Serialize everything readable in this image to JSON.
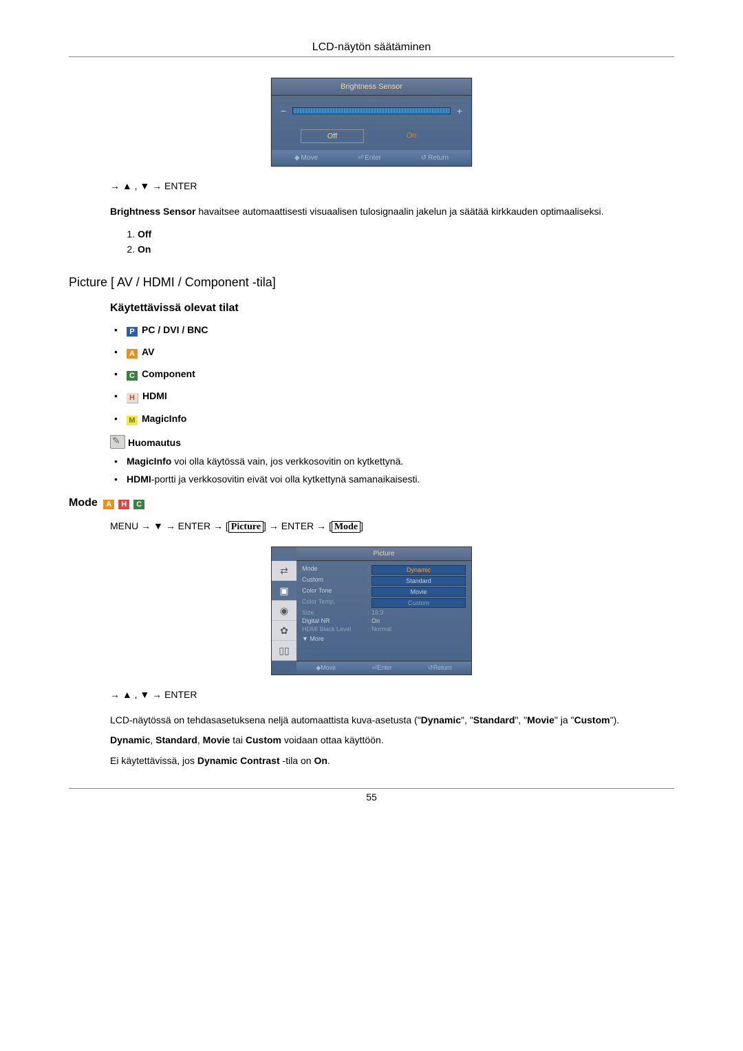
{
  "header": {
    "title": "LCD-näytön säätäminen"
  },
  "footer": {
    "page": "55"
  },
  "osd_brightness": {
    "title": "Brightness Sensor",
    "minus": "−",
    "plus": "+",
    "option_off": "Off",
    "option_on": "On",
    "foot_move": "Move",
    "foot_enter": "Enter",
    "foot_return": "Return"
  },
  "nav1": "→ ▲ , ▼ → ENTER",
  "desc_b": {
    "prefix": "Brightness Sensor",
    "rest": " havaitsee automaattisesti visuaalisen tulosignaalin jakelun ja säätää kirkkauden optimaaliseksi."
  },
  "list1": {
    "item1": "Off",
    "item2": "On"
  },
  "h_picture": "Picture [ AV / HDMI / Component -tila]",
  "h_modes": "Käytettävissä olevat tilat",
  "modes": {
    "p": {
      "letter": "P",
      "label": "PC / DVI / BNC"
    },
    "a": {
      "letter": "A",
      "label": "AV"
    },
    "c": {
      "letter": "C",
      "label": "Component"
    },
    "h": {
      "letter": "H",
      "label": "HDMI"
    },
    "m": {
      "letter": "M",
      "label": "MagicInfo"
    }
  },
  "note_label": "Huomautus",
  "notes": {
    "n1_b": "MagicInfo",
    "n1_rest": " voi olla käytössä vain, jos verkkosovitin on kytkettynä.",
    "n2_b": "HDMI",
    "n2_rest": "-portti ja verkkosovitin eivät voi olla kytkettynä samanaikaisesti."
  },
  "h_mode": "Mode",
  "menupath": {
    "p1": "MENU → ▼ → ENTER → ",
    "box1": "Picture",
    "p2": " → ENTER → ",
    "box2": "Mode"
  },
  "osd_picture": {
    "title": "Picture",
    "items": [
      {
        "label": "Mode",
        "value": "Dynamic",
        "pill": true,
        "first": true
      },
      {
        "label": "Custom",
        "value": "Standard",
        "pill": true
      },
      {
        "label": "Color Tone",
        "value": "Movie",
        "pill": true
      },
      {
        "label": "Color Temp.",
        "value": "Custom",
        "pill": true,
        "dim": true
      },
      {
        "label": "Size",
        "value": "16:9",
        "dim": true
      },
      {
        "label": "Digital NR",
        "value": "On"
      },
      {
        "label": "HDMI Black Level",
        "value": "Normal",
        "dim": true
      }
    ],
    "more": "▼ More",
    "foot_move": "Move",
    "foot_enter": "Enter",
    "foot_return": "Return"
  },
  "nav2": "→ ▲ , ▼ → ENTER",
  "p_preset": {
    "a": "LCD-näytössä on tehdasasetuksena neljä automaattista kuva-asetusta (\"",
    "b1": "Dynamic",
    "b": "\", \"",
    "b2": "Standard",
    "c": "\", \"",
    "b3": "Movie",
    "d": "\" ja \"",
    "b4": "Custom",
    "e": "\")."
  },
  "p_activate": {
    "b1": "Dynamic",
    "s1": ", ",
    "b2": "Standard",
    "s2": ", ",
    "b3": "Movie",
    "s3": " tai ",
    "b4": "Custom",
    "s4": " voidaan ottaa käyttöön."
  },
  "p_notavail": {
    "a": "Ei käytettävissä, jos ",
    "b": "Dynamic Contrast",
    "c": " -tila on ",
    "d": "On",
    "e": "."
  }
}
